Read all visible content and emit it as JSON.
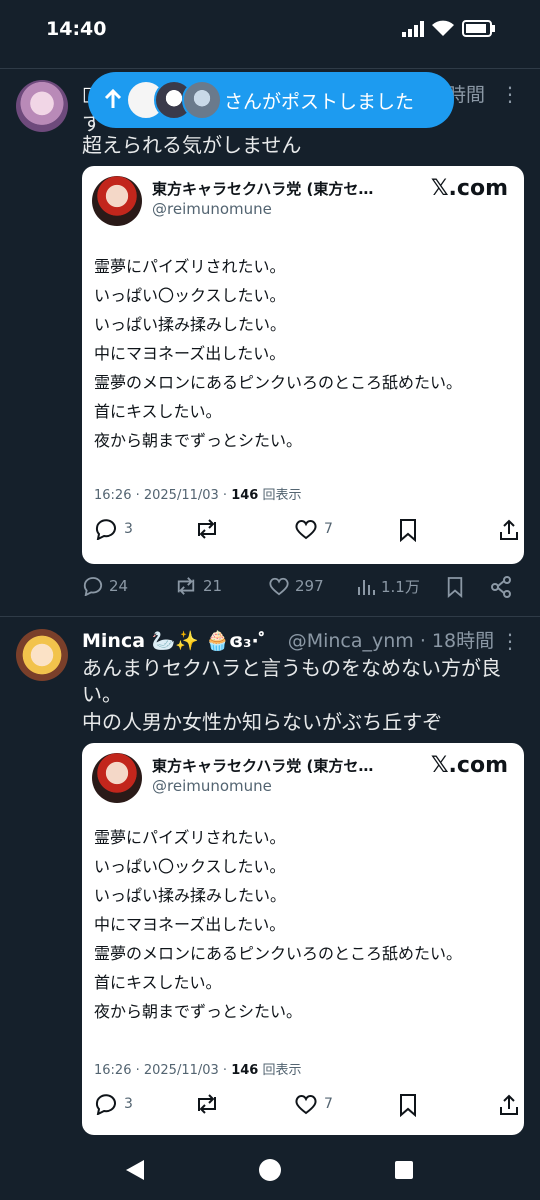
{
  "status_bar": {
    "time": "14:40"
  },
  "pill": {
    "text": "さんがポストしました"
  },
  "tweet1": {
    "name_partial": "□",
    "time": "時間",
    "text_line1_partial": "す",
    "text_line2": "超えられる気がしません",
    "card": {
      "name": "東方キャラセクハラ党 (東方セ…",
      "handle": "@reimunomune",
      "brand": "𝕏.com",
      "lines": [
        "霊夢にパイズリされたい。",
        "いっぱい〇ックスしたい。",
        "いっぱい揉み揉みしたい。",
        "中にマヨネーズ出したい。",
        "霊夢のメロンにあるピンクいろのところ舐めたい。",
        "首にキスしたい。",
        "夜から朝までずっとシたい。"
      ],
      "meta_time": "16:26 · 2025/11/03 · ",
      "meta_views": "146",
      "meta_views_label": " 回表示",
      "replies": "3",
      "likes": "7"
    },
    "replies": "24",
    "retweets": "21",
    "likes": "297",
    "views": "1.1万"
  },
  "tweet2": {
    "name": "Minca 🦢✨ 🧁ɞ₃·゜",
    "handle_time": "@Minca_ynm · 18時間",
    "text_line1": "あんまりセクハラと言うものをなめない方が良",
    "text_line2": "い。",
    "text_line3": "中の人男か女性か知らないがぶち丘すぞ",
    "card": {
      "name": "東方キャラセクハラ党 (東方セ…",
      "handle": "@reimunomune",
      "brand": "𝕏.com",
      "lines": [
        "霊夢にパイズリされたい。",
        "いっぱい〇ックスしたい。",
        "いっぱい揉み揉みしたい。",
        "中にマヨネーズ出したい。",
        "霊夢のメロンにあるピンクいろのところ舐めたい。",
        "首にキスしたい。",
        "夜から朝までずっとシたい。"
      ],
      "meta_time": "16:26 · 2025/11/03 · ",
      "meta_views": "146",
      "meta_views_label": " 回表示",
      "replies": "3",
      "likes": "7"
    }
  },
  "colors": {
    "bg": "#15202b",
    "accent": "#1d9bf0",
    "muted": "#8b98a5"
  },
  "icons": [
    "signal-icon",
    "wifi-icon",
    "battery-icon",
    "reply-icon",
    "retweet-icon",
    "like-icon",
    "views-icon",
    "bookmark-icon",
    "share-icon",
    "back-icon",
    "home-icon",
    "recents-icon",
    "arrow-up-icon"
  ]
}
